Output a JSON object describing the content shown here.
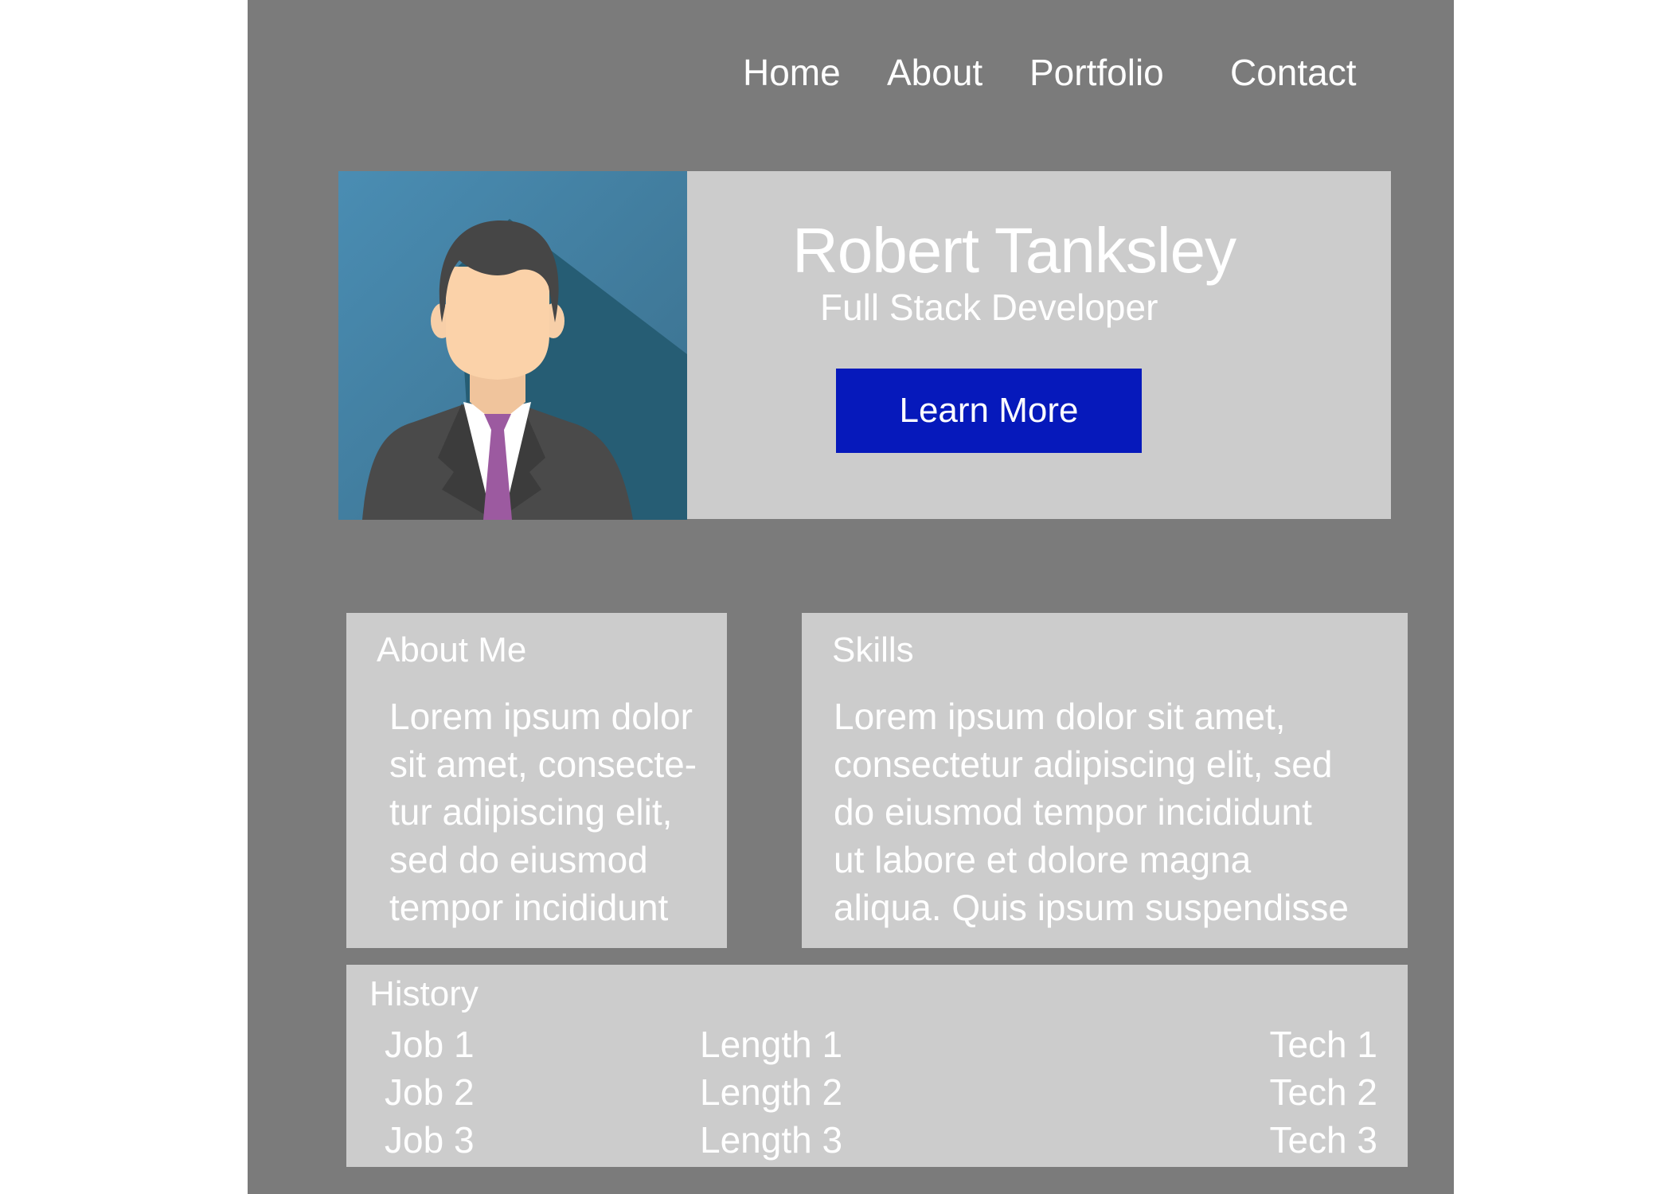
{
  "nav": {
    "items": [
      "Home",
      "About",
      "Portfolio",
      "Contact"
    ]
  },
  "hero": {
    "name": "Robert Tanksley",
    "title": "Full Stack Developer",
    "button_label": "Learn More",
    "portrait_icon": "person-avatar-icon"
  },
  "about": {
    "heading": "About Me",
    "lines": [
      "Lorem ipsum dolor",
      "sit amet, consecte-",
      "tur adipiscing elit,",
      "sed do eiusmod",
      "tempor incididunt"
    ]
  },
  "skills": {
    "heading": "Skills",
    "lines": [
      "Lorem ipsum dolor sit amet,",
      "consectetur adipiscing elit, sed",
      "do eiusmod tempor incididunt",
      "ut labore et dolore magna",
      "aliqua. Quis ipsum suspendisse"
    ]
  },
  "history": {
    "heading": "History",
    "rows": [
      {
        "job": "Job 1",
        "length": "Length 1",
        "tech": "Tech 1"
      },
      {
        "job": "Job 2",
        "length": "Length 2",
        "tech": "Tech 2"
      },
      {
        "job": "Job 3",
        "length": "Length 3",
        "tech": "Tech 3"
      }
    ]
  },
  "colors": {
    "page_background": "#7b7b7b",
    "panel": "#cccccc",
    "button": "#0619bb",
    "portrait_bg": "#3f7fa0",
    "tie": "#9c5aa0"
  }
}
